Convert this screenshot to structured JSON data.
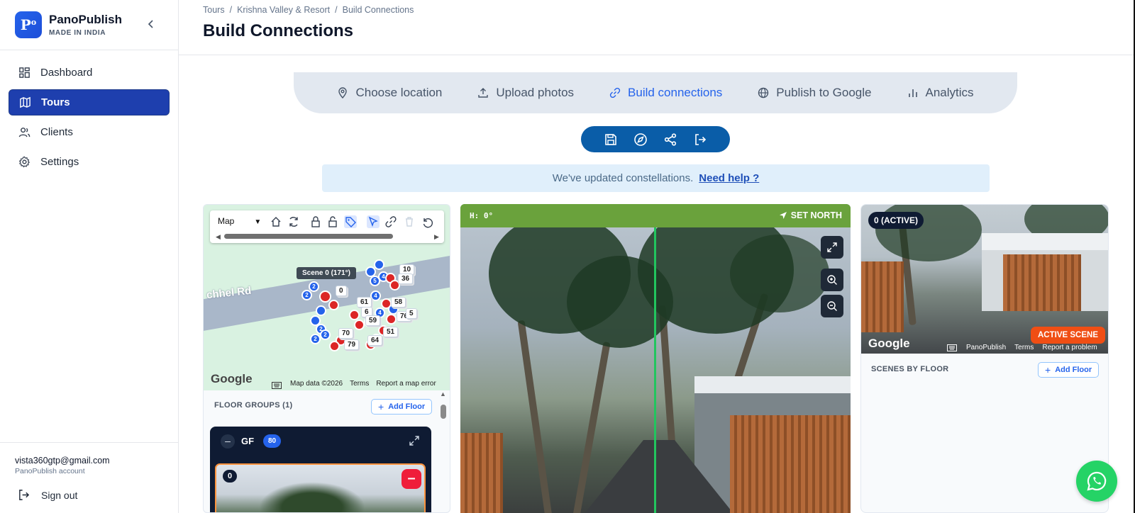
{
  "brand": {
    "name": "PanoPublish",
    "tagline": "MADE IN INDIA",
    "logo_text": "P",
    "logo_sup": "o"
  },
  "sidebar": {
    "items": [
      {
        "label": "Dashboard",
        "icon": "dashboard-icon"
      },
      {
        "label": "Tours",
        "icon": "map-icon",
        "active": true
      },
      {
        "label": "Clients",
        "icon": "users-icon"
      },
      {
        "label": "Settings",
        "icon": "gear-icon"
      }
    ],
    "account_email": "vista360gtp@gmail.com",
    "account_sub": "PanoPublish account",
    "signout_label": "Sign out"
  },
  "breadcrumb": {
    "items": [
      "Tours",
      "Krishna Valley & Resort",
      "Build Connections"
    ]
  },
  "page_title": "Build Connections",
  "steps": [
    {
      "label": "Choose location",
      "icon": "location-pin-icon"
    },
    {
      "label": "Upload photos",
      "icon": "upload-icon"
    },
    {
      "label": "Build connections",
      "icon": "link-icon",
      "active": true
    },
    {
      "label": "Publish to Google",
      "icon": "globe-icon"
    },
    {
      "label": "Analytics",
      "icon": "bar-chart-icon"
    }
  ],
  "notice": {
    "text": "We've updated constellations.",
    "link": "Need help ?"
  },
  "map": {
    "select_value": "Map",
    "road_name": "chhel Rd",
    "tooltip": "Scene 0 (171°)",
    "google": "Google",
    "attribution": [
      "Map data ©2026",
      "Terms",
      "Report a map error"
    ],
    "pin_labels": [
      "2",
      "2",
      "2",
      "4",
      "5",
      "4",
      "2",
      "4",
      "2",
      "2",
      "2",
      "2"
    ],
    "chips": [
      "10",
      "36",
      "0",
      "61",
      "58",
      "6",
      "76",
      "6",
      "59",
      "51",
      "70",
      "64",
      "79",
      "5"
    ]
  },
  "floor_groups": {
    "title": "FLOOR GROUPS (1)",
    "add_label": "Add Floor",
    "floor_name": "GF",
    "floor_count": "80",
    "scene_index": "0"
  },
  "pano": {
    "heading": "H: 0°",
    "set_north": "SET NORTH",
    "accent": "#6aa23c",
    "north_line_color": "#22c55e"
  },
  "right": {
    "active_badge": "0 (ACTIVE)",
    "active_scene": "ACTIVE SCENE",
    "google": "Google",
    "attribution": [
      "PanoPublish",
      "Terms",
      "Report a problem"
    ],
    "scenes_title": "SCENES BY FLOOR",
    "add_label": "Add Floor"
  },
  "colors": {
    "primary": "#1e3fae",
    "toolbar": "#0a5da8",
    "whatsapp": "#25d366",
    "danger": "#ef1d3a",
    "active_scene": "#f04e14"
  }
}
